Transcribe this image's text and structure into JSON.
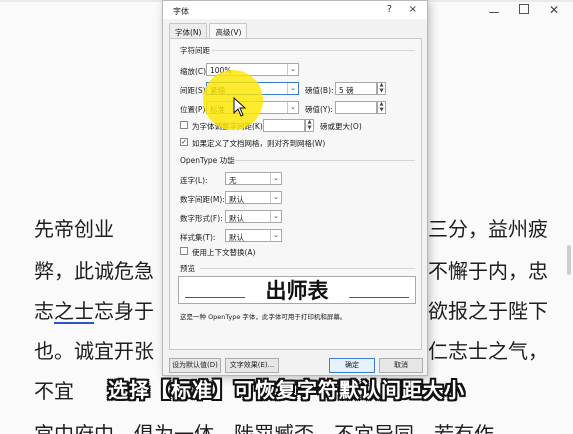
{
  "document": {
    "left_lines": [
      "先帝创业",
      "弊，此诚危急",
      "志之士忘身于",
      "也。诚宜开张",
      "不宜",
      "宫中府中，俱为一体，陟罚臧否，不宜异同，若有作"
    ],
    "right_lines": [
      "三分，益州疲",
      "不懈于内，忠",
      "欲报之于陛下",
      "仁志士之气，"
    ],
    "underline_segment": "之士"
  },
  "dialog": {
    "title": "字体",
    "help": "?",
    "close": "×",
    "tabs": [
      {
        "label": "字体(N)",
        "active": false
      },
      {
        "label": "高级(V)",
        "active": true
      }
    ],
    "char_spacing": {
      "section_title": "字符间距",
      "scale_label": "缩放(C):",
      "scale_value": "100%",
      "spacing_label": "间距(S):",
      "spacing_value": "紧缩",
      "spacing_by_label": "磅值(B):",
      "spacing_by_value": "5 磅",
      "position_label": "位置(P):",
      "position_value": "标准",
      "position_by_label": "磅值(Y):",
      "position_by_value": "",
      "kerning_label": "为字体调整字间距(K):",
      "kerning_value": "",
      "kerning_suffix": "磅或更大(O)",
      "grid_label": "如果定义了文档网格，则对齐到网格(W)",
      "grid_checked": true,
      "kerning_checked": false
    },
    "opentype": {
      "section_title": "OpenType 功能",
      "ligatures_label": "连字(L):",
      "ligatures_value": "无",
      "num_spacing_label": "数字间距(M):",
      "num_spacing_value": "默认",
      "num_forms_label": "数字形式(F):",
      "num_forms_value": "默认",
      "stylistic_label": "样式集(T):",
      "stylistic_value": "默认",
      "contextual_label": "使用上下文替换(A)",
      "contextual_checked": false
    },
    "preview": {
      "section_title": "预览",
      "sample": "出师表",
      "note": "这是一种 OpenType 字体，此字体可用于打印机和屏幕。"
    },
    "buttons": {
      "set_default": "设为默认值(D)",
      "text_effects": "文字效果(E)...",
      "ok": "确定",
      "cancel": "取消"
    }
  },
  "caption": "选择【标准】可恢复字符默认间距大小",
  "colors": {
    "highlight": "#ffe600",
    "focus": "#3b7bd6"
  }
}
